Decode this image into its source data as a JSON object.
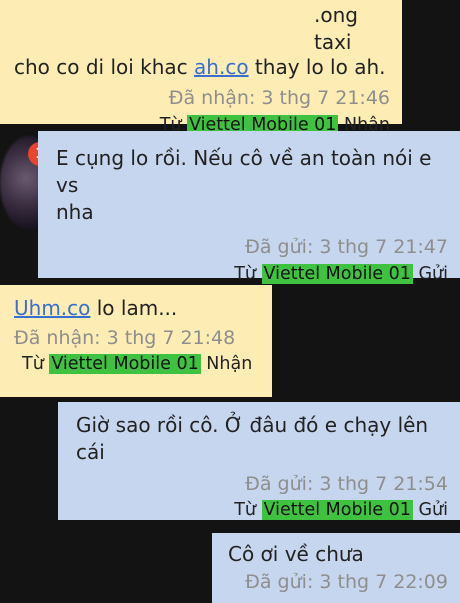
{
  "messages": [
    {
      "direction": "received",
      "line1": ".ong taxi",
      "line2_pre": "cho co di loi khac ",
      "line2_link": "ah.co",
      "line2_post": " thay lo lo ah.",
      "status": "Đã nhận: 3 thg 7 21:46",
      "via_prefix": "Từ ",
      "carrier": "Viettel Mobile 01",
      "via_suffix": " Nhận"
    },
    {
      "direction": "sent",
      "line1": "E cụng lo rồi. Nếu cô về an toàn nói e vs",
      "line2": "nha",
      "status": "Đã gửi: 3 thg 7 21:47",
      "via_prefix": "Từ ",
      "carrier": "Viettel Mobile 01",
      "via_suffix": " Gửi"
    },
    {
      "direction": "received",
      "link": "Uhm.co",
      "text_post": " lo lam...",
      "status": "Đã nhận: 3 thg 7 21:48",
      "via_prefix": "Từ ",
      "carrier": "Viettel Mobile 01",
      "via_suffix": " Nhận"
    },
    {
      "direction": "sent",
      "text": "Giờ sao rồi cô. Ở đâu đó e chạy lên cái",
      "status": "Đã gửi: 3 thg 7 21:54",
      "via_prefix": "Từ ",
      "carrier": "Viettel Mobile 01",
      "via_suffix": " Gửi"
    },
    {
      "direction": "sent",
      "text": "Cô ơi về chưa",
      "status": "Đã gửi: 3 thg 7 22:09"
    }
  ],
  "unread_badge": "1",
  "colors": {
    "background": "#131313",
    "received_bubble": "#fdedb4",
    "sent_bubble": "#c7d6ef",
    "carrier_highlight": "#3fc23f",
    "link": "#3a6fd1",
    "badge": "#e8442e"
  }
}
